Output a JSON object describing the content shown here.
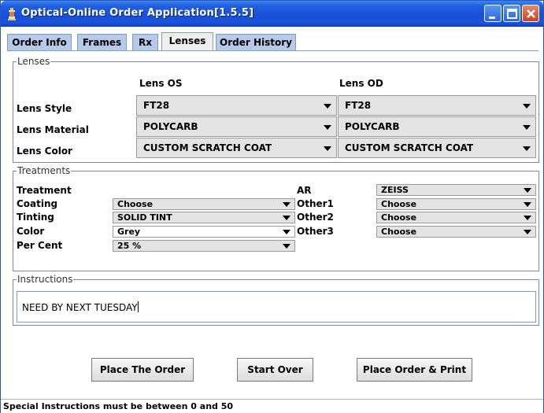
{
  "window": {
    "title": "Optical-Online Order Application[1.5.5]"
  },
  "tabs": [
    {
      "label": "Order Info"
    },
    {
      "label": "Frames"
    },
    {
      "label": "Rx"
    },
    {
      "label": "Lenses",
      "active": true
    },
    {
      "label": "Order History"
    }
  ],
  "lenses": {
    "group_title": "Lenses",
    "col_os": "Lens OS",
    "col_od": "Lens OD",
    "rows": [
      {
        "label": "Lens Style",
        "os": "FT28",
        "od": "FT28"
      },
      {
        "label": "Lens Material",
        "os": "POLYCARB",
        "od": "POLYCARB"
      },
      {
        "label": "Lens Color",
        "os": "CUSTOM SCRATCH COAT",
        "od": "CUSTOM SCRATCH COAT"
      }
    ]
  },
  "treatments": {
    "group_title": "Treatments",
    "treatment_label": "Treatment",
    "coating": {
      "label": "Coating",
      "value": "Choose"
    },
    "tinting": {
      "label": "Tinting",
      "value": "SOLID TINT"
    },
    "color": {
      "label": "Color",
      "value": "Grey"
    },
    "per_cent": {
      "label": "Per Cent",
      "value": "25 %"
    },
    "ar": {
      "label": "AR",
      "value": "ZEISS"
    },
    "other1": {
      "label": "Other1",
      "value": "Choose"
    },
    "other2": {
      "label": "Other2",
      "value": "Choose"
    },
    "other3": {
      "label": "Other3",
      "value": "Choose"
    }
  },
  "instructions": {
    "group_title": "Instructions",
    "value": "NEED BY NEXT TUESDAY"
  },
  "buttons": {
    "place_order": "Place The Order",
    "start_over": "Start Over",
    "place_print": "Place Order & Print"
  },
  "status": "Special Instructions must be between 0 and 50",
  "colors": {
    "title_bar": "#1650d8",
    "tab": "#b6c9e8",
    "combo": "#e3e3e3"
  }
}
